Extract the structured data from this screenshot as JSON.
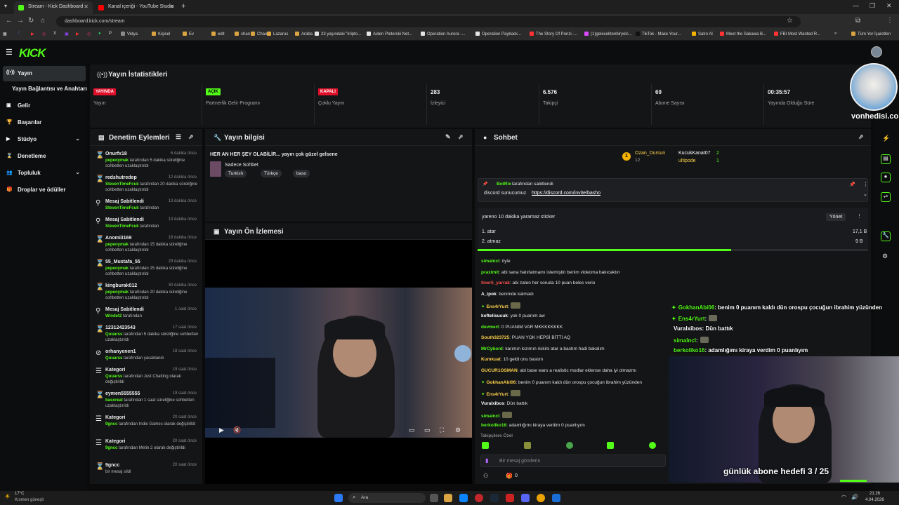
{
  "browser": {
    "tabs": [
      {
        "label": "Stream - Kick Dashboard",
        "color": "#53fc18"
      },
      {
        "label": "Kanal içeriği - YouTube Studio",
        "color": "#ff0000"
      }
    ],
    "url": "dashboard.kick.com/stream",
    "bookmarks": [
      "Vidya",
      "Kişisel",
      "Ev",
      "edit",
      "chan",
      "Chao",
      "Lazarus",
      "Araba",
      "23 yaşındaki \"kripto...",
      "Aiden Pleterski Net...",
      "Operation Aurora -...",
      "Operation Payback...",
      "The Story Of Ponzi -...",
      "(1)gelecektenbiryolc...",
      "TikTok - Make Your...",
      "Satın Al",
      "Meet the Sakawa B...",
      "FBI Most Wanted R..."
    ],
    "bookmarks_all": "Tüm Yer İşaretleri"
  },
  "kick": {
    "logo": "KICK"
  },
  "sidebar": {
    "items": [
      {
        "label": "Yayın",
        "icon": "broadcast-icon"
      },
      {
        "label": "Yayın Bağlantısı ve Anahtarı",
        "icon": ""
      },
      {
        "label": "Gelir",
        "icon": "wallet-icon"
      },
      {
        "label": "Başarılar",
        "icon": "trophy-icon"
      },
      {
        "label": "Stüdyo",
        "icon": "camera-icon",
        "chevron": "⌄"
      },
      {
        "label": "Denetleme",
        "icon": "shield-icon"
      },
      {
        "label": "Topluluk",
        "icon": "people-icon",
        "chevron": "⌄"
      },
      {
        "label": "Droplar ve ödüller",
        "icon": "gift-icon"
      }
    ]
  },
  "stats": {
    "title": "Yayın İstatistikleri",
    "items": [
      {
        "badge": "YAYINDA",
        "badge_color": "#e1102a",
        "label": "Yayın"
      },
      {
        "badge": "AÇIK",
        "badge_color": "#53fc18",
        "label": "Partnerlik Gelir Programı"
      },
      {
        "badge": "KAPALI",
        "badge_color": "#e1102a",
        "label": "Çoklu Yayın"
      },
      {
        "value": "283",
        "label": "İzleyici"
      },
      {
        "value": "6.576",
        "label": "Takipçi"
      },
      {
        "value": "69",
        "label": "Abone Sayısı"
      },
      {
        "value": "00:35:57",
        "label": "Yayında Olduğu Süre"
      }
    ]
  },
  "moderation": {
    "title": "Denetim Eylemleri",
    "items": [
      {
        "name": "Onurfx18",
        "time": "6 dakika önce",
        "actor": "pepeoymak",
        "desc": " tarafından 5 dakika süreliğine sohbetten uzaklaştırıldı"
      },
      {
        "name": "redshutredep",
        "time": "12 dakika önce",
        "actor": "StevenTimeFcuk",
        "desc": " tarafından 20 dakika süreliğine sohbetten uzaklaştırıldı"
      },
      {
        "name": "Mesaj Sabitlendi",
        "time": "13 dakika önce",
        "actor": "StevenTimeFcuk",
        "desc": " tarafından"
      },
      {
        "name": "Mesaj Sabitlendi",
        "time": "13 dakika önce",
        "actor": "StevenTimeFcuk",
        "desc": " tarafından"
      },
      {
        "name": "Anomi3169",
        "time": "18 dakika önce",
        "actor": "pepeoymak",
        "desc": " tarafından 15 dakika süreliğine sohbetten uzaklaştırıldı"
      },
      {
        "name": "55_Mustafa_55",
        "time": "29 dakika önce",
        "actor": "pepeoymak",
        "desc": " tarafından 15 dakika süreliğine sohbetten uzaklaştırıldı"
      },
      {
        "name": "kingburak012",
        "time": "30 dakika önce",
        "actor": "pepeoymak",
        "desc": " tarafından 20 dakika süreliğine sohbetten uzaklaştırıldı"
      },
      {
        "name": "Mesaj Sabitlendi",
        "time": "1 saat önce",
        "actor": "Windet2",
        "desc": " tarafından"
      },
      {
        "name": "12312423543",
        "time": "17 saat önce",
        "actor": "Quuarss",
        "desc": " tarafından 5 dakika süreliğine sohbetten uzaklaştırıldı"
      },
      {
        "name": "orhanyenen1",
        "time": "18 saat önce",
        "actor": "Quuarss",
        "desc": " tarafından yasaklandı"
      },
      {
        "name": "Kategori",
        "time": "19 saat önce",
        "actor": "Quuarss",
        "desc": " tarafından Just Chatting olarak değiştirildi"
      },
      {
        "name": "eymen5555555",
        "time": "19 saat önce",
        "actor": "basoreal",
        "desc": " tarafından 1 saat süreliğine sohbetten uzaklaştırıldı"
      },
      {
        "name": "Kategori",
        "time": "20 saat önce",
        "actor": "9gncc",
        "desc": " tarafından Indie Games olarak değiştirildi"
      },
      {
        "name": "Kategori",
        "time": "20 saat önce",
        "actor": "9gncc",
        "desc": " tarafından Metin 2 olarak değiştirildi"
      },
      {
        "name": "9gncc",
        "time": "20 saat önce",
        "actor": "",
        "desc": "bir mesaj sildi"
      }
    ],
    "icons": [
      "⌛",
      "⌛",
      "⚲",
      "⚲",
      "⌛",
      "⌛",
      "⌛",
      "⚲",
      "⌛",
      "⊘",
      "☰",
      "⌛",
      "☰",
      "☰",
      "⌛"
    ]
  },
  "stream_info": {
    "title_label": "Yayın bilgisi",
    "stream_title": "HER AN HER ŞEY OLABİLİR... yayın çok güzel gelsene",
    "category": "Sadece Sohbet",
    "tags": [
      "Turkish",
      "Türkçe",
      "baso"
    ]
  },
  "preview": {
    "title": "Yayın Ön İzlemesi"
  },
  "chat": {
    "title": "Sohbet",
    "top_users": [
      {
        "name": "Ozan_Dursun",
        "count": "12"
      },
      {
        "name": "KucukKanat07",
        "count": "2"
      },
      {
        "name": "ultipode",
        "count": "1"
      }
    ],
    "pinned": {
      "by": "BotRix",
      "by_suffix": " tarafından sabitlendi",
      "text": "discord sunucumuz ",
      "link": "https://discord.com/invite/basho"
    },
    "poll": {
      "title": "yareno 10 dakika yaramaz sticker",
      "manage": "Yönet",
      "options": [
        {
          "label": "1. atar",
          "count": "17,1 B"
        },
        {
          "label": "2. atmaz",
          "count": "9 B"
        }
      ],
      "fraction": 0.65
    },
    "messages": [
      {
        "user": "simalncl",
        "color": "#53fc18",
        "text": "öyle"
      },
      {
        "user": "praximit",
        "color": "#53fc18",
        "text": "abi sana hatırlatmamı istemiştin benim videoma bakıcaktın"
      },
      {
        "user": "tinerli_yarrak",
        "color": "#ff5252",
        "text": "abi zaten her soruda 10 puan beles verio"
      },
      {
        "user": "A_ipok",
        "color": "#ffffff",
        "text": "benimde kalmadı"
      },
      {
        "user": "Ens4rYurt",
        "color": "#ffd24a",
        "text": ""
      },
      {
        "user": "koftelisucuk",
        "color": "#ffffff",
        "text": "yok 0 puanım aw"
      },
      {
        "user": "devmert",
        "color": "#53fc18",
        "text": "0 PUANIM VAR MKKKKKKKK"
      },
      {
        "user": "South323725",
        "color": "#ffd24a",
        "text": "PUAN YOK HEPSİ BİTTİ AQ"
      },
      {
        "user": "MrCybord",
        "color": "#53fc18",
        "text": "karımın kızımın riskini atar a bastım hadi bakalım"
      },
      {
        "user": "Kumkuat",
        "color": "#ffd24a",
        "text": "10 geldi onu bastım"
      },
      {
        "user": "GUCUR1OSMAN",
        "color": "#ffd24a",
        "text": "abi base wars a realistic modlar eklense daha iyi olmazmı"
      },
      {
        "user": "GokhanAbi06",
        "color": "#ffd24a",
        "text": "benim 0 puanım kaldı dün orospu çocuğun ibrahim yüzünden"
      },
      {
        "user": "Ens4rYurt",
        "color": "#ffd24a",
        "text": ""
      },
      {
        "user": "Vuralxibos",
        "color": "#ffffff",
        "text": "Dün battık"
      },
      {
        "user": "simalncl",
        "color": "#53fc18",
        "text": ""
      },
      {
        "user": "berkoliko16",
        "color": "#53fc18",
        "text": "adamlığımı kiraya verdim 0 puanlıyım"
      }
    ],
    "followers_label": "Takipçilere Özel",
    "input_placeholder": "Bir mesaj gönderin",
    "points": "0"
  },
  "overlay": {
    "messages": [
      {
        "user": "GokhanAbi06",
        "color": "#53fc18",
        "text": ": benim 0 puanım kaldı dün orospu çocuğun ibrahim yüzünden"
      },
      {
        "user": "Ens4rYurt",
        "color": "#53fc18",
        "text": ":"
      },
      {
        "user": "Vuralxibos",
        "color": "#ffffff",
        "text": ": Dün battık"
      },
      {
        "user": "simalncl",
        "color": "#53fc18",
        "text": ":"
      },
      {
        "user": "berkoliko16",
        "color": "#53fc18",
        "text": ": adamlığımı kiraya verdim 0 puanlıyım"
      }
    ],
    "goal": "günlük abone hedefi 3 / 25",
    "watermark": "vonhedisi.com"
  },
  "taskbar": {
    "weather_temp": "17°C",
    "weather_desc": "Kısmen güneşli",
    "search": "Ara",
    "time": "21:26",
    "date": "4.04.2026"
  },
  "colors": {
    "accent": "#53fc18",
    "live": "#e1102a",
    "panel": "#141517"
  }
}
